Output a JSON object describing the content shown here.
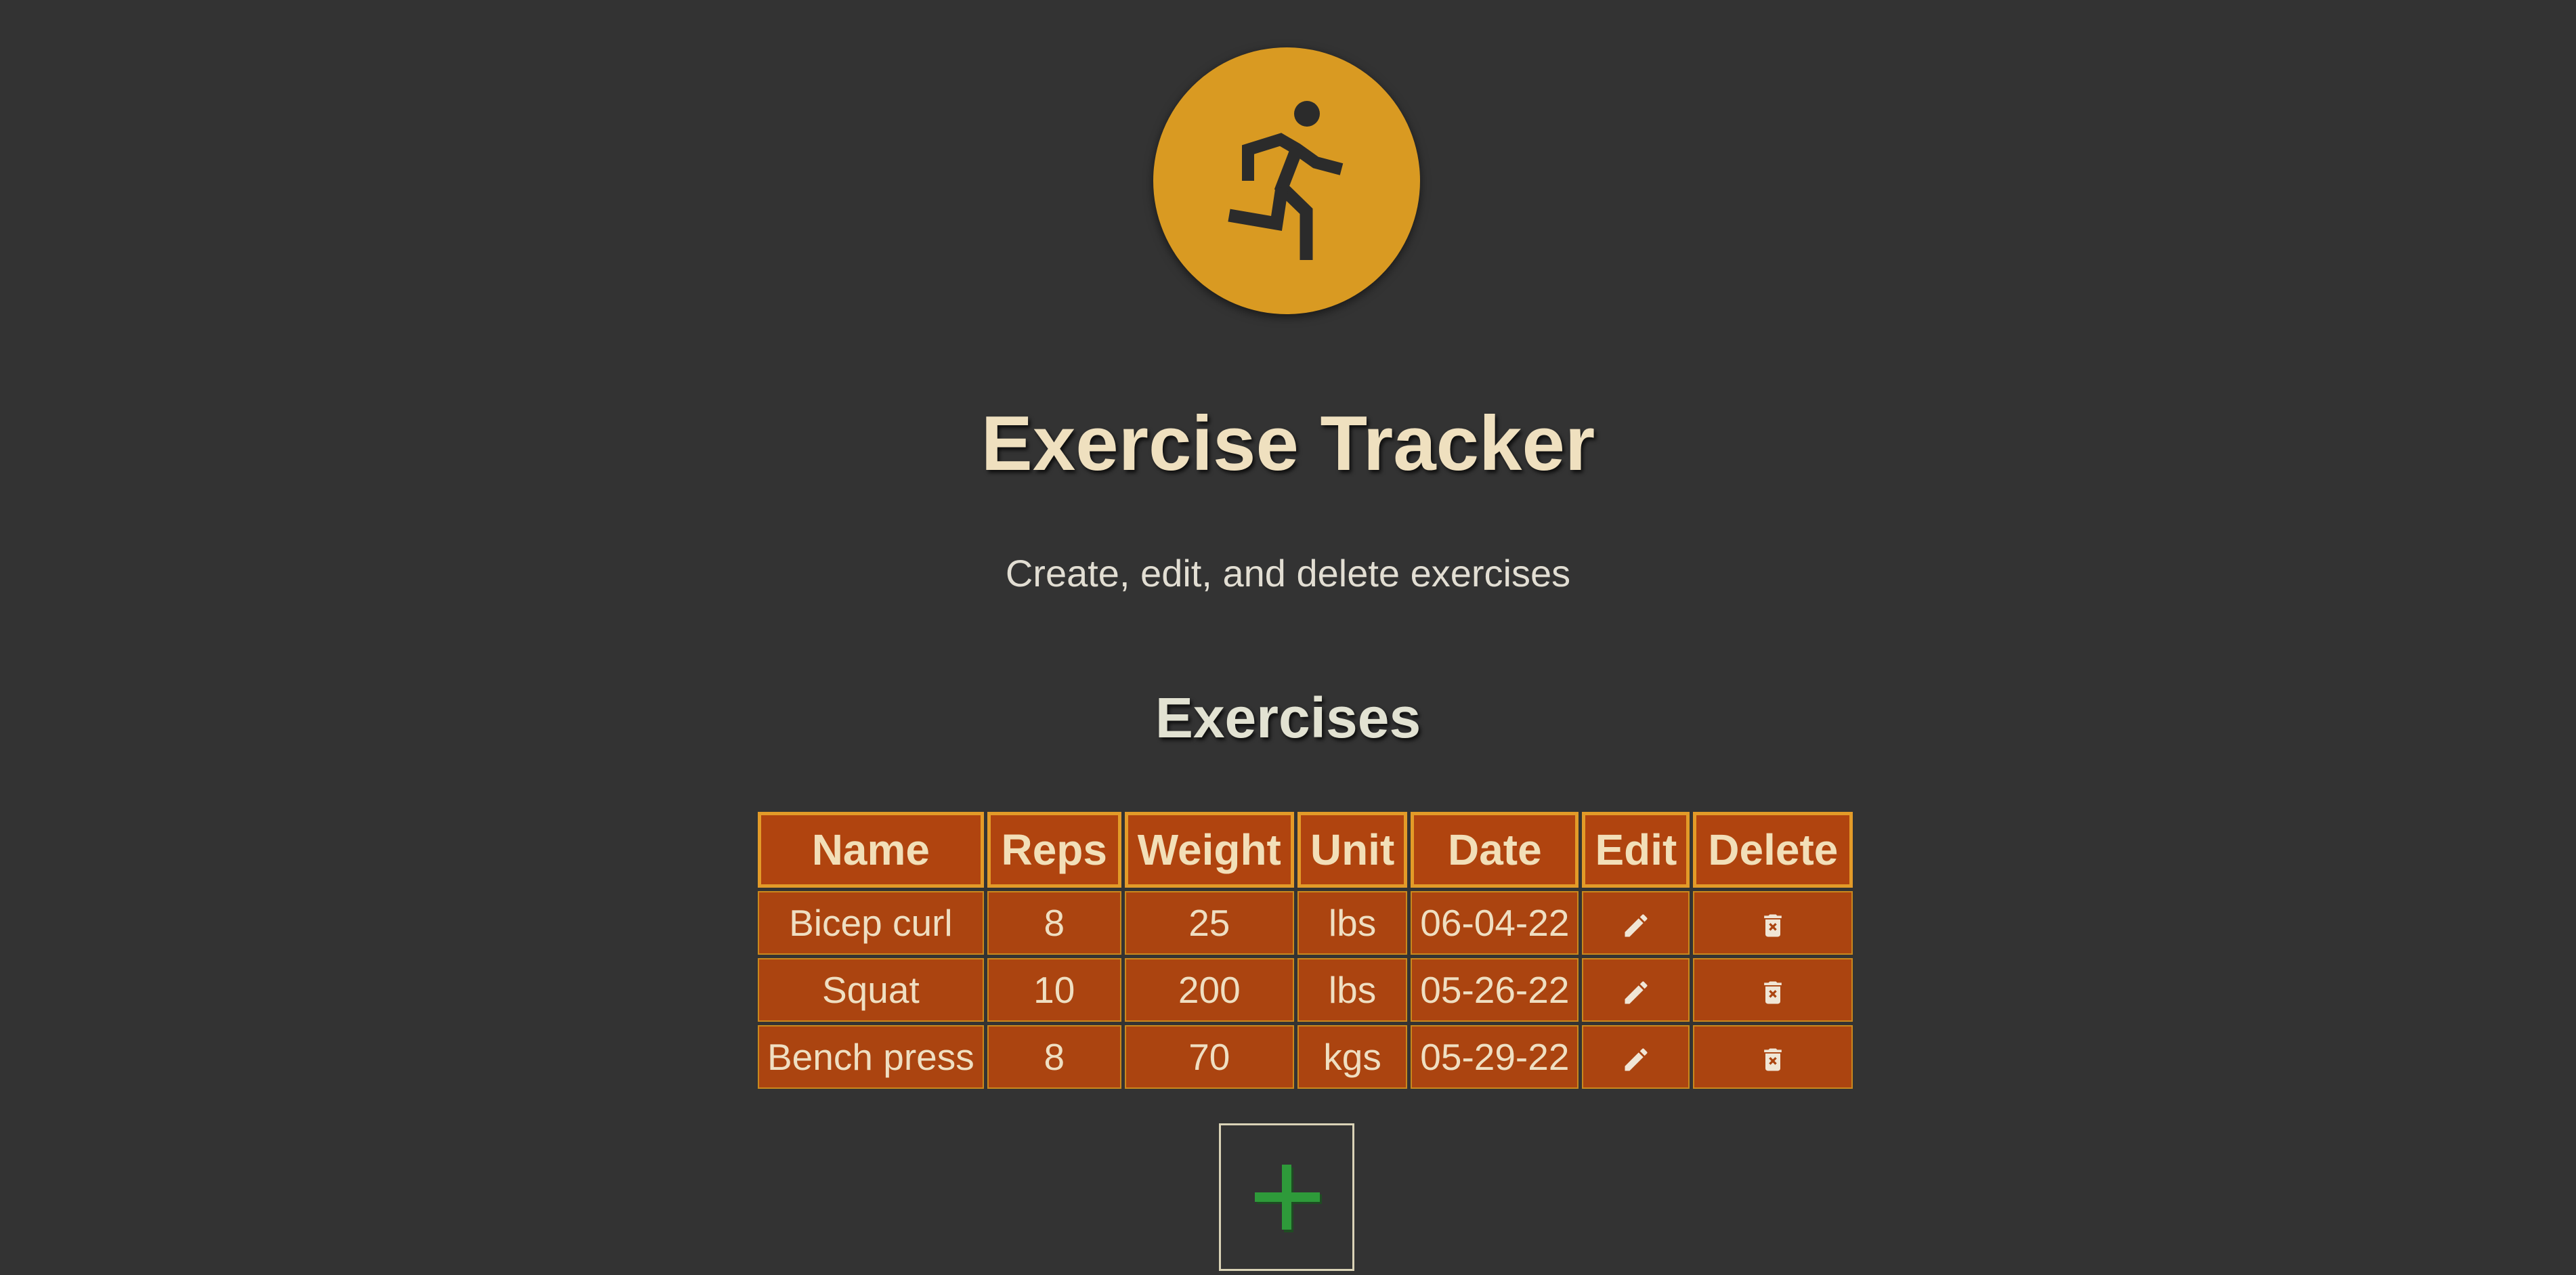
{
  "header": {
    "logo_icon": "running-person-icon",
    "title": "Exercise Tracker",
    "subtitle": "Create, edit, and delete exercises"
  },
  "section": {
    "title": "Exercises"
  },
  "table": {
    "columns": [
      "Name",
      "Reps",
      "Weight",
      "Unit",
      "Date",
      "Edit",
      "Delete"
    ],
    "rows": [
      {
        "name": "Bicep curl",
        "reps": "8",
        "weight": "25",
        "unit": "lbs",
        "date": "06-04-22"
      },
      {
        "name": "Squat",
        "reps": "10",
        "weight": "200",
        "unit": "lbs",
        "date": "05-26-22"
      },
      {
        "name": "Bench press",
        "reps": "8",
        "weight": "70",
        "unit": "kgs",
        "date": "05-29-22"
      }
    ],
    "edit_icon": "pencil-icon",
    "delete_icon": "trash-icon"
  },
  "add_button": {
    "icon": "plus-icon"
  },
  "colors": {
    "background": "#333333",
    "logo_circle": "#d99a22",
    "table_cell": "#ab4410",
    "header_border": "#e39b28",
    "plus": "#2e9a3a"
  }
}
